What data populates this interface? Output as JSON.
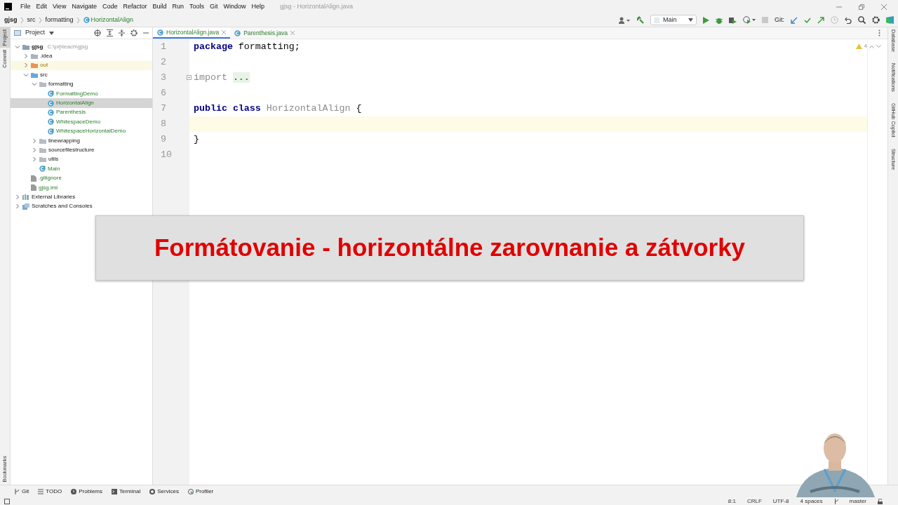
{
  "window": {
    "title": "gjsg - HorizontalAlign.java"
  },
  "menu": [
    "File",
    "Edit",
    "View",
    "Navigate",
    "Code",
    "Refactor",
    "Build",
    "Run",
    "Tools",
    "Git",
    "Window",
    "Help"
  ],
  "breadcrumbs": [
    {
      "label": "gjsg",
      "kind": "project"
    },
    {
      "label": "src",
      "kind": "folder"
    },
    {
      "label": "formatting",
      "kind": "folder"
    },
    {
      "label": "HorizontalAlign",
      "kind": "class"
    }
  ],
  "toolbar": {
    "run_config": "Main",
    "git_label": "Git:"
  },
  "left_stripe": [
    {
      "label": "Project",
      "selected": true
    },
    {
      "label": "Commit",
      "selected": false
    }
  ],
  "left_stripe_bottom": "Bookmarks",
  "project_panel": {
    "title": "Project",
    "tree": [
      {
        "label": "gjsg",
        "kind": "module",
        "path": "C:\\prj\\teach\\gjsg",
        "expanded": true,
        "selected": false,
        "children": [
          {
            "label": ".idea",
            "kind": "folder",
            "expanded": false,
            "selected": false
          },
          {
            "label": "out",
            "kind": "excluded",
            "expanded": false,
            "selected": false
          },
          {
            "label": "src",
            "kind": "source",
            "expanded": true,
            "selected": false,
            "children": [
              {
                "label": "formatting",
                "kind": "package",
                "expanded": true,
                "selected": false,
                "children": [
                  {
                    "label": "FormattingDemo",
                    "kind": "main-class",
                    "selected": false
                  },
                  {
                    "label": "HorizontalAlign",
                    "kind": "class",
                    "selected": true
                  },
                  {
                    "label": "Parenthesis",
                    "kind": "class",
                    "selected": false
                  },
                  {
                    "label": "WhitespaceDemo",
                    "kind": "class",
                    "selected": false
                  },
                  {
                    "label": "WhitespaceHorizontalDemo",
                    "kind": "main-class",
                    "selected": false
                  }
                ]
              },
              {
                "label": "linewrapping",
                "kind": "package",
                "expanded": false,
                "selected": false
              },
              {
                "label": "sourcefilestructure",
                "kind": "package",
                "expanded": false,
                "selected": false
              },
              {
                "label": "utils",
                "kind": "package",
                "expanded": false,
                "selected": false
              },
              {
                "label": "Main",
                "kind": "main-class",
                "selected": false
              }
            ]
          },
          {
            "label": ".gitignore",
            "kind": "file",
            "selected": false
          },
          {
            "label": "gjsg.iml",
            "kind": "file",
            "selected": false
          }
        ]
      },
      {
        "label": "External Libraries",
        "kind": "library",
        "expanded": false,
        "selected": false
      },
      {
        "label": "Scratches and Consoles",
        "kind": "scratch",
        "expanded": false,
        "selected": false
      }
    ]
  },
  "editor": {
    "tabs": [
      {
        "label": "HorizontalAlign.java",
        "selected": true
      },
      {
        "label": "Parenthesis.java",
        "selected": false
      }
    ],
    "warnings": "4",
    "lines": [
      {
        "number": "1",
        "current": false,
        "tokens": [
          {
            "text": "package",
            "kind": "keyword"
          },
          {
            "text": "formatting;",
            "kind": "plain"
          }
        ]
      },
      {
        "number": "2",
        "current": false
      },
      {
        "number": "3",
        "current": false,
        "folded": true,
        "tokens": [
          {
            "text": "import",
            "kind": "unused"
          },
          {
            "text": "...",
            "kind": "fold"
          }
        ]
      },
      {
        "number": "6",
        "current": false
      },
      {
        "number": "7",
        "current": false,
        "tokens": [
          {
            "text": "public",
            "kind": "keyword"
          },
          {
            "text": "class",
            "kind": "keyword"
          },
          {
            "text": "HorizontalAlign",
            "kind": "unused"
          },
          {
            "text": "{",
            "kind": "plain"
          }
        ]
      },
      {
        "number": "8",
        "current": true
      },
      {
        "number": "9",
        "current": false,
        "tokens": [
          {
            "text": "}",
            "kind": "plain"
          }
        ]
      },
      {
        "number": "10",
        "current": false
      }
    ]
  },
  "right_stripe": [
    "Database",
    "Notifications",
    "GitHub Copilot",
    "Structure"
  ],
  "bottom_tabs": [
    "Git",
    "TODO",
    "Problems",
    "Terminal",
    "Services",
    "Profiler"
  ],
  "status_bar": [
    "8:1",
    "CRLF",
    "UTF-8",
    "4 spaces",
    "master"
  ],
  "banner": {
    "text": "Formátovanie - horizontálne zarovnanie a zátvorky"
  },
  "video": {
    "kind": "picture"
  }
}
